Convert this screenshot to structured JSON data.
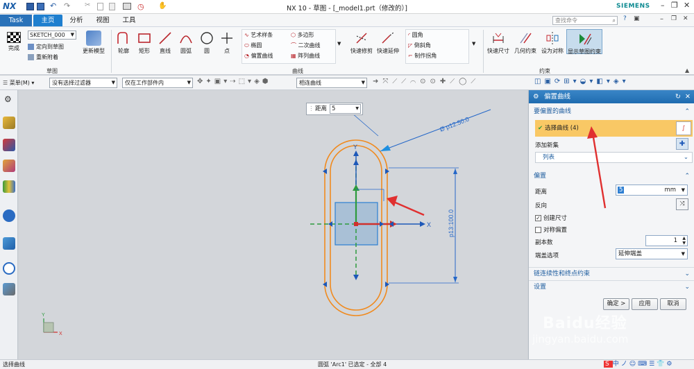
{
  "app": {
    "logo": "NX",
    "title": "NX 10 - 草图 - [_model1.prt（修改的）]",
    "brand": "SIEMENS"
  },
  "tabs": [
    {
      "label": "Task"
    },
    {
      "label": "主页"
    },
    {
      "label": "分析"
    },
    {
      "label": "视图"
    },
    {
      "label": "工具"
    }
  ],
  "search": {
    "placeholder": "查找命令"
  },
  "ribbon": {
    "sketch_group": {
      "finish_label": "完成",
      "sketch_name": "SKETCH_000",
      "orient_label": "定向到草图",
      "reattach_label": "重新附着",
      "update_label": "更新模型",
      "group_label": "草图"
    },
    "curve_tools": [
      "轮廓",
      "矩形",
      "直线",
      "圆弧",
      "圆",
      "点"
    ],
    "curve_list_col1": [
      "艺术样条",
      "椭圆",
      "偏置曲线"
    ],
    "curve_list_col2": [
      "多边形",
      "二次曲线",
      "阵列曲线"
    ],
    "edit_tools": [
      "快速修剪",
      "快速延伸"
    ],
    "corner_list": [
      "圆角",
      "倒斜角",
      "制作拐角"
    ],
    "curve_group_label": "曲线",
    "constraint_tools": [
      "快速尺寸",
      "几何约束",
      "设为对称",
      "显示草图约束"
    ],
    "constraint_group_label": "约束"
  },
  "toolbar": {
    "menu_label": "菜单(M)",
    "filter": "没有选择过滤器",
    "scope": "仅在工作部件内",
    "curve_rule": "相连曲线"
  },
  "canvas": {
    "distance_label": "距离",
    "distance_value": "5",
    "dim_diameter": "Ø p12:50.0",
    "dim_length": "p13:100.0",
    "axis_x": "X",
    "axis_y": "Y"
  },
  "panel": {
    "title": "偏置曲线",
    "section_curves": "要偏置的曲线",
    "select_curve_label": "选择曲线 (4)",
    "add_new_set": "添加新集",
    "list_label": "列表",
    "section_offset": "偏置",
    "distance_label": "距离",
    "distance_value": "5",
    "distance_unit": "mm",
    "reverse_label": "反向",
    "create_dim_label": "创建尺寸",
    "create_dim_checked": true,
    "symmetric_label": "对称偏置",
    "symmetric_checked": false,
    "copies_label": "副本数",
    "copies_value": "1",
    "cap_label": "端盖选项",
    "cap_value": "延伸端盖",
    "section_chain": "链连续性和终点约束",
    "section_settings": "设置",
    "ok_label": "确定 >",
    "apply_label": "应用",
    "cancel_label": "取消"
  },
  "status": {
    "left": "选择曲线",
    "center": "圆弧 'Arc1' 已选定 - 全部 4"
  },
  "watermark": {
    "brand": "Baidu经验",
    "url": "jingyan.baidu.com"
  },
  "colors": {
    "accent": "#1e6fb6",
    "select_highlight": "#f9c865",
    "curve": "#f08a1e",
    "tab_active": "#1f7fcf"
  }
}
